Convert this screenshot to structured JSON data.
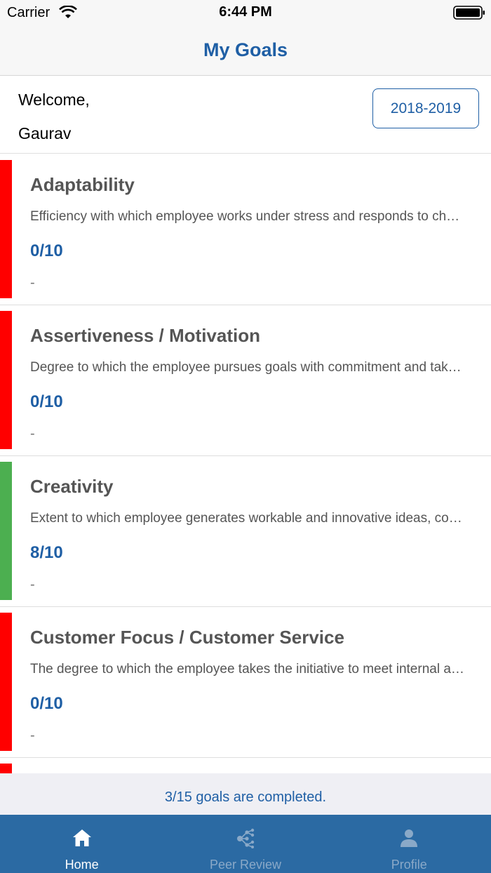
{
  "status_bar": {
    "carrier": "Carrier",
    "time": "6:44 PM"
  },
  "nav": {
    "title": "My Goals"
  },
  "header": {
    "welcome": "Welcome,",
    "user_name": "Gaurav",
    "year_button": "2018-2019"
  },
  "goals": [
    {
      "title": "Adaptability",
      "description": "Efficiency with which employee works under stress and responds to ch…",
      "score": "0/10",
      "extra": "-",
      "status_color": "#ff0000"
    },
    {
      "title": "Assertiveness / Motivation",
      "description": "Degree to which the employee pursues goals with commitment and tak…",
      "score": "0/10",
      "extra": "-",
      "status_color": "#ff0000"
    },
    {
      "title": "Creativity",
      "description": "Extent to which employee generates workable and innovative ideas, co…",
      "score": "8/10",
      "extra": "-",
      "status_color": "#4caf50"
    },
    {
      "title": "Customer Focus / Customer Service",
      "description": "The degree to which the employee takes the initiative to meet internal a…",
      "score": "0/10",
      "extra": "-",
      "status_color": "#ff0000"
    },
    {
      "title": "",
      "description": "",
      "score": "",
      "extra": "",
      "status_color": "#ff0000"
    }
  ],
  "summary": {
    "text": "3/15 goals are completed."
  },
  "tabs": [
    {
      "label": "Home",
      "icon": "home-icon",
      "active": true
    },
    {
      "label": "Peer Review",
      "icon": "network-icon",
      "active": false
    },
    {
      "label": "Profile",
      "icon": "person-icon",
      "active": false
    }
  ],
  "colors": {
    "accent": "#1f5fa5",
    "tab_bar": "#2b6aa3",
    "status_red": "#ff0000",
    "status_green": "#4caf50"
  }
}
